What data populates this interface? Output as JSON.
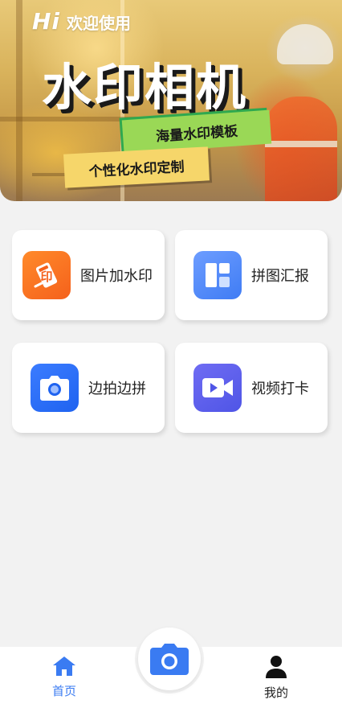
{
  "banner": {
    "hi": "Hi",
    "welcome": "欢迎使用",
    "title": "水印相机",
    "tag_green": "海量水印模板",
    "tag_yellow": "个性化水印定制"
  },
  "features": [
    {
      "label": "图片加水印",
      "icon": "watermark-stamp-icon",
      "color": "#f5611c"
    },
    {
      "label": "拼图汇报",
      "icon": "collage-grid-icon",
      "color": "#3f7cf4"
    },
    {
      "label": "边拍边拼",
      "icon": "camera-icon",
      "color": "#1f63f0"
    },
    {
      "label": "视频打卡",
      "icon": "video-camera-icon",
      "color": "#4f55e6"
    }
  ],
  "nav": {
    "home_label": "首页",
    "mine_label": "我的",
    "active_color": "#3a7bf2"
  }
}
